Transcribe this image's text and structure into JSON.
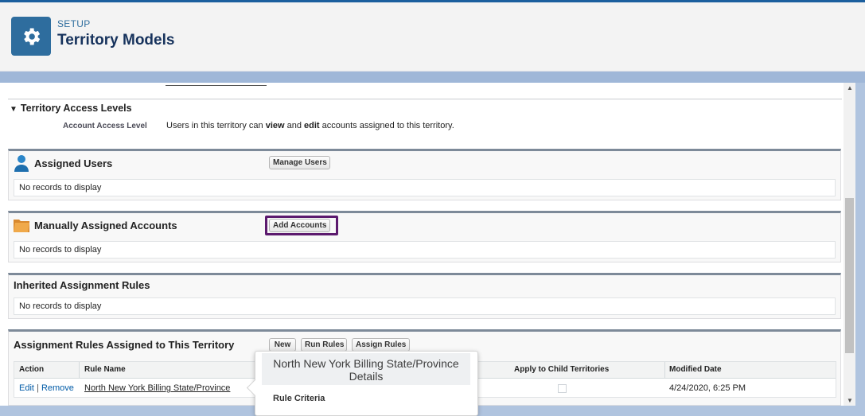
{
  "header": {
    "section_label": "SETUP",
    "title": "Territory Models",
    "icon": "gear-icon",
    "accent_color": "#2e6d9e"
  },
  "access_levels": {
    "title": "Territory Access Levels",
    "account_label": "Account Access Level",
    "account_value_pre": "Users in this territory can ",
    "account_value_view": "view",
    "account_value_and": " and ",
    "account_value_edit": "edit",
    "account_value_post": " accounts assigned to this territory."
  },
  "assigned_users": {
    "title": "Assigned Users",
    "icon": "user-icon",
    "button": "Manage Users",
    "empty": "No records to display"
  },
  "manual_accounts": {
    "title": "Manually Assigned Accounts",
    "icon": "folder-icon",
    "button": "Add Accounts",
    "empty": "No records to display",
    "highlight_color": "#5c1a6e"
  },
  "inherited_rules": {
    "title": "Inherited Assignment Rules",
    "empty": "No records to display"
  },
  "assignment_rules": {
    "title": "Assignment Rules Assigned to This Territory",
    "buttons": {
      "new": "New",
      "run": "Run Rules",
      "assign": "Assign Rules"
    },
    "columns": {
      "action": "Action",
      "rule_name": "Rule Name",
      "apply_child": "Apply to Child Territories",
      "modified": "Modified Date"
    },
    "rows": [
      {
        "edit": "Edit",
        "separator": " | ",
        "remove": "Remove",
        "rule_name": "North New York Billing State/Province",
        "apply_child": false,
        "modified": "4/24/2020, 6:25 PM"
      }
    ]
  },
  "popover": {
    "title": "North New York Billing State/Province Details",
    "subheading": "Rule Criteria"
  }
}
